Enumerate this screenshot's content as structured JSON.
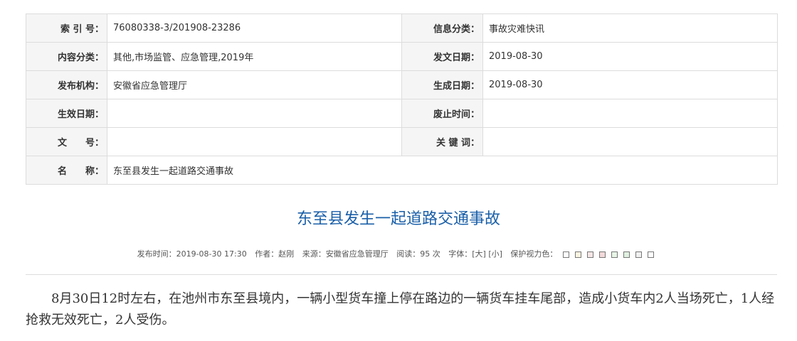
{
  "meta": {
    "rows": [
      {
        "l1": "索 引 号：",
        "v1": "76080338-3/201908-23286",
        "l2": "信息分类：",
        "v2": "事故灾难快讯"
      },
      {
        "l1": "内容分类：",
        "v1": "其他,市场监管、应急管理,2019年",
        "l2": "发文日期：",
        "v2": "2019-08-30"
      },
      {
        "l1": "发布机构：",
        "v1": "安徽省应急管理厅",
        "l2": "生成日期：",
        "v2": "2019-08-30"
      },
      {
        "l1": "生效日期：",
        "v1": "",
        "l2": "废止时间：",
        "v2": ""
      },
      {
        "l1": "文　　号：",
        "v1": "",
        "l2": "关 键 词：",
        "v2": ""
      }
    ],
    "name_label": "名　　称：",
    "name_value": "东至县发生一起道路交通事故"
  },
  "article": {
    "title": "东至县发生一起道路交通事故",
    "info": {
      "publish_time": "发布时间：2019-08-30 17:30",
      "author": "作者：赵刚",
      "source": "来源：安徽省应急管理厅",
      "views": "阅读：95 次",
      "font_label": "字体：",
      "font_large": "[大]",
      "font_small": "[小]",
      "eye_label": "保护视力色："
    },
    "eye_colors": [
      "#ffffff",
      "#faf3e0",
      "#f5e6e6",
      "#f2d9d9",
      "#e6f5e6",
      "#e0f0e0",
      "#f0f0f0",
      "#ffffff"
    ],
    "body": "8月30日12时左右，在池州市东至县境内，一辆小型货车撞上停在路边的一辆货车挂车尾部，造成小货车内2人当场死亡，1人经抢救无效死亡，2人受伤。"
  }
}
